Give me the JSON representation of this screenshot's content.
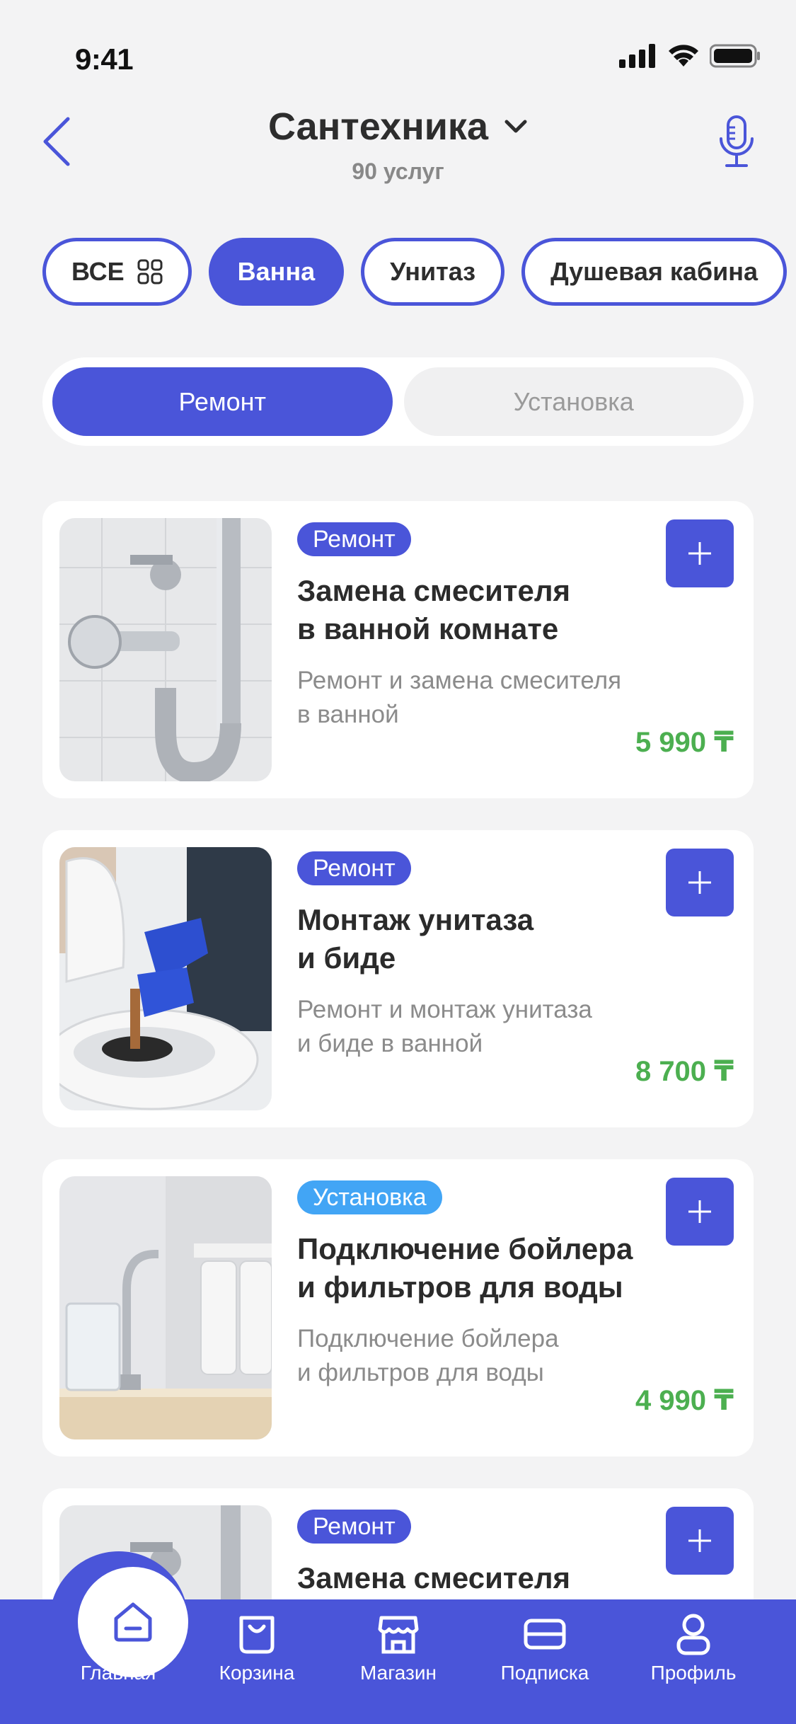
{
  "status": {
    "time": "9:41"
  },
  "header": {
    "title": "Сантехника",
    "subtitle": "90 услуг"
  },
  "chips": [
    {
      "label": "ВСЕ",
      "active": false
    },
    {
      "label": "Ванна",
      "active": true
    },
    {
      "label": "Унитаз",
      "active": false
    },
    {
      "label": "Душевая кабина",
      "active": false
    }
  ],
  "segments": [
    {
      "label": "Ремонт",
      "active": true
    },
    {
      "label": "Установка",
      "active": false
    }
  ],
  "cards": [
    {
      "tag": "Ремонт",
      "tag_color": "#4a55d9",
      "title_line1": "Замена смесителя",
      "title_line2": "в ванной комнате",
      "desc_line1": "Ремонт и замена смесителя",
      "desc_line2": "в ванной",
      "price": "5 990 ₸"
    },
    {
      "tag": "Ремонт",
      "tag_color": "#4a55d9",
      "title_line1": "Монтаж унитаза",
      "title_line2": "и биде",
      "desc_line1": "Ремонт и монтаж унитаза",
      "desc_line2": "и биде в ванной",
      "price": "8 700 ₸"
    },
    {
      "tag": "Установка",
      "tag_color": "#42a5f5",
      "title_line1": "Подключение бойлера",
      "title_line2": "и фильтров для воды",
      "desc_line1": "Подключение бойлера",
      "desc_line2": "и фильтров для воды",
      "price": "4 990 ₸"
    },
    {
      "tag": "Ремонт",
      "tag_color": "#4a55d9",
      "title_line1": "Замена смесителя",
      "title_line2": "",
      "desc_line1": "",
      "desc_line2": "",
      "price": ""
    }
  ],
  "nav": [
    {
      "label": "Главная",
      "icon": "home-icon"
    },
    {
      "label": "Корзина",
      "icon": "bag-icon"
    },
    {
      "label": "Магазин",
      "icon": "store-icon"
    },
    {
      "label": "Подписка",
      "icon": "card-icon"
    },
    {
      "label": "Профиль",
      "icon": "profile-icon"
    }
  ],
  "colors": {
    "accent": "#4a55d9",
    "price": "#4caf50",
    "tag_install": "#42a5f5"
  }
}
